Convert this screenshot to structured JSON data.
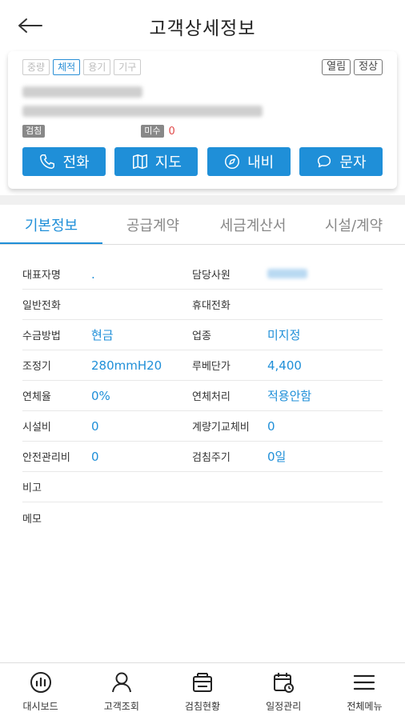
{
  "header": {
    "title": "고객상세정보",
    "back_icon": "arrow-left-icon"
  },
  "card": {
    "meter_tags": [
      {
        "label": "중량",
        "active": false
      },
      {
        "label": "체적",
        "active": true
      },
      {
        "label": "용기",
        "active": false
      },
      {
        "label": "기구",
        "active": false
      }
    ],
    "status_tags": [
      "열림",
      "정상"
    ],
    "inspection_label": "검침",
    "unpaid_label": "미수",
    "unpaid_value": "0",
    "actions": [
      {
        "label": "전화",
        "icon": "phone-icon"
      },
      {
        "label": "지도",
        "icon": "map-icon"
      },
      {
        "label": "내비",
        "icon": "compass-icon"
      },
      {
        "label": "문자",
        "icon": "message-icon"
      }
    ]
  },
  "tabs": [
    "기본정보",
    "공급계약",
    "세금계산서",
    "시설/계약"
  ],
  "info": {
    "rows": [
      {
        "l1": "대표자명",
        "v1": ".",
        "l2": "담당사원",
        "v2": ""
      },
      {
        "l1": "일반전화",
        "v1": "",
        "l2": "휴대전화",
        "v2": ""
      },
      {
        "l1": "수금방법",
        "v1": "현금",
        "l2": "업종",
        "v2": "미지정"
      },
      {
        "l1": "조정기",
        "v1": "280mmH20",
        "l2": "루베단가",
        "v2": "4,400"
      },
      {
        "l1": "연체율",
        "v1": "0%",
        "l2": "연체처리",
        "v2": "적용안함"
      },
      {
        "l1": "시설비",
        "v1": "0",
        "l2": "계량기교체비",
        "v2": "0"
      },
      {
        "l1": "안전관리비",
        "v1": "0",
        "l2": "검침주기",
        "v2": "0일"
      },
      {
        "l1": "비고",
        "v1": "",
        "l2": "",
        "v2": ""
      },
      {
        "l1": "메모",
        "v1": "",
        "l2": "",
        "v2": ""
      }
    ]
  },
  "bottom_nav": [
    {
      "label": "대시보드",
      "icon": "dashboard-icon"
    },
    {
      "label": "고객조회",
      "icon": "user-icon"
    },
    {
      "label": "검침현황",
      "icon": "meter-icon"
    },
    {
      "label": "일정관리",
      "icon": "calendar-icon"
    },
    {
      "label": "전체메뉴",
      "icon": "menu-icon"
    }
  ],
  "colors": {
    "accent": "#1f8fd8",
    "unpaid": "#e04a4a"
  }
}
